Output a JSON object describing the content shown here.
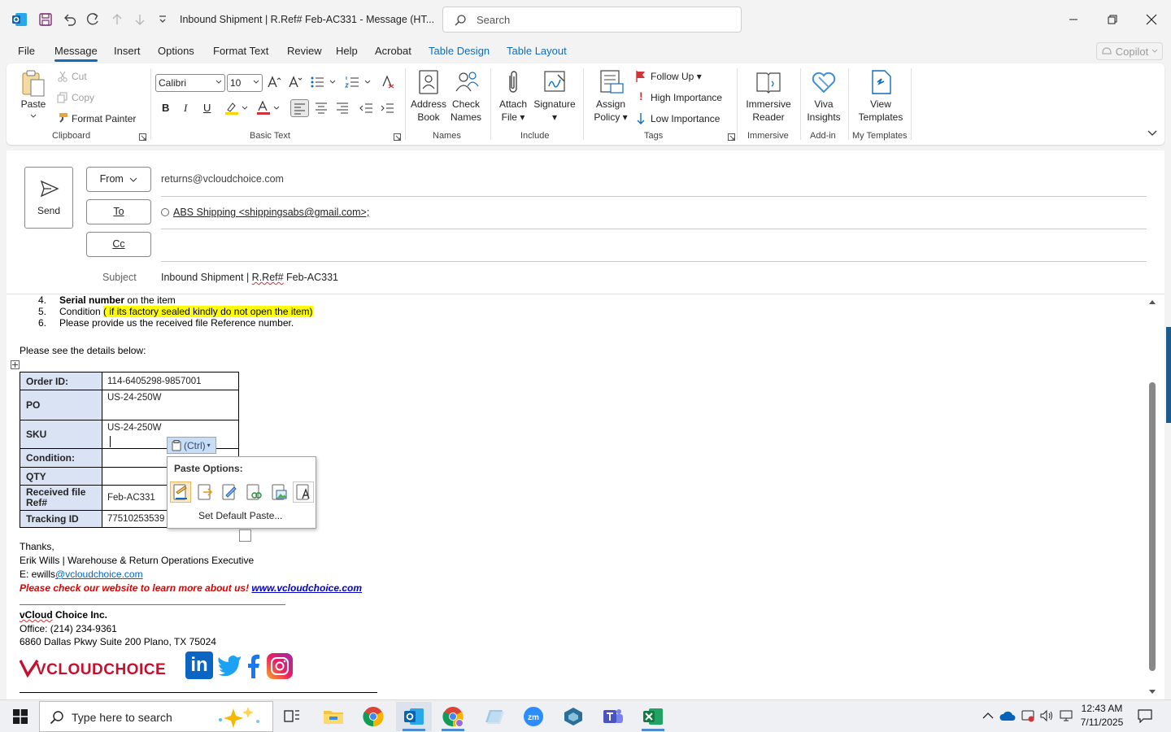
{
  "window": {
    "title": "Inbound Shipment | R.Ref# Feb-AC331  -  Message (HT...",
    "search_placeholder": "Search"
  },
  "tabs": [
    {
      "label": "File"
    },
    {
      "label": "Message",
      "active": true
    },
    {
      "label": "Insert"
    },
    {
      "label": "Options"
    },
    {
      "label": "Format Text"
    },
    {
      "label": "Review"
    },
    {
      "label": "Help"
    },
    {
      "label": "Acrobat"
    },
    {
      "label": "Table Design",
      "contextual": true
    },
    {
      "label": "Table Layout",
      "contextual": true
    }
  ],
  "copilot_label": "Copilot",
  "ribbon": {
    "clipboard": {
      "paste": "Paste",
      "cut": "Cut",
      "copy": "Copy",
      "format_painter": "Format Painter",
      "label": "Clipboard"
    },
    "basic_text": {
      "font": "Calibri",
      "size": "10",
      "label": "Basic Text"
    },
    "names": {
      "address_book": [
        "Address",
        "Book"
      ],
      "check_names": [
        "Check",
        "Names"
      ],
      "label": "Names"
    },
    "include": {
      "attach": [
        "Attach",
        "File"
      ],
      "signature": "Signature",
      "label": "Include"
    },
    "tags": {
      "assign_policy": [
        "Assign",
        "Policy"
      ],
      "follow_up": "Follow Up",
      "high": "High Importance",
      "low": "Low Importance",
      "label": "Tags"
    },
    "immersive": {
      "reader": [
        "Immersive",
        "Reader"
      ],
      "label": "Immersive"
    },
    "addin": {
      "viva": [
        "Viva",
        "Insights"
      ],
      "label": "Add-in"
    },
    "templates": {
      "view": [
        "View",
        "Templates"
      ],
      "label": "My Templates"
    }
  },
  "colors": {
    "accent": "#0f6cbd",
    "highlight": "#ffff00",
    "table_key_bg": "#dae3f3",
    "promo": "#e00000"
  },
  "compose": {
    "send": "Send",
    "from_btn": "From",
    "from_addr": "returns@vcloudchoice.com",
    "to_btn": "To",
    "to_recipient": "ABS Shipping <shippingsabs@gmail.com>;",
    "cc_btn": "Cc",
    "subject_label": "Subject",
    "subject": {
      "pre": "Inbound Shipment | ",
      "squiggle": "R.Ref#",
      "post": " Feb-AC331"
    }
  },
  "body": {
    "list": [
      {
        "num": "4.",
        "bold": "Serial number",
        "text": " on the item"
      },
      {
        "num": "5.",
        "text": "Condition ",
        "highlight": "( if its factory sealed kindly do not open the item)"
      },
      {
        "num": "6.",
        "text": "Please provide us the received file Reference number."
      }
    ],
    "intro": "Please see the details below:",
    "table": [
      {
        "key": "Order ID:",
        "value": "114-6405298-9857001"
      },
      {
        "key": "PO",
        "value": "US-24-250W"
      },
      {
        "key": "SKU",
        "value": "US-24-250W"
      },
      {
        "key": "Condition:",
        "value": ""
      },
      {
        "key": "QTY",
        "value": ""
      },
      {
        "key": "Received file Ref#",
        "value": "Feb-AC331"
      },
      {
        "key": "Tracking ID",
        "value": "77510253539"
      }
    ],
    "thanks": "Thanks,",
    "sig_name": "Erik Wills | Warehouse & Return Operations Executive",
    "sig_email_prefix": "E: ewills",
    "sig_email_link": "@vcloudchoice.com",
    "promo_text": "Please check our website to learn more about us! ",
    "promo_link": "www.vcloudchoice.com",
    "company_squiggle": "vCloud",
    "company_rest": " Choice Inc.",
    "office": "Office: (214) 234-9361",
    "address": "6860 Dallas Pkwy Suite 200 Plano, TX 75024",
    "logo_text": "VCLOUDCHOICE"
  },
  "paste": {
    "ctrl_label": "(Ctrl)",
    "menu_title": "Paste Options:",
    "set_default": "Set Default Paste..."
  },
  "taskbar": {
    "search_placeholder": "Type here to search",
    "time": "12:43 AM",
    "date": "7/11/2025"
  }
}
